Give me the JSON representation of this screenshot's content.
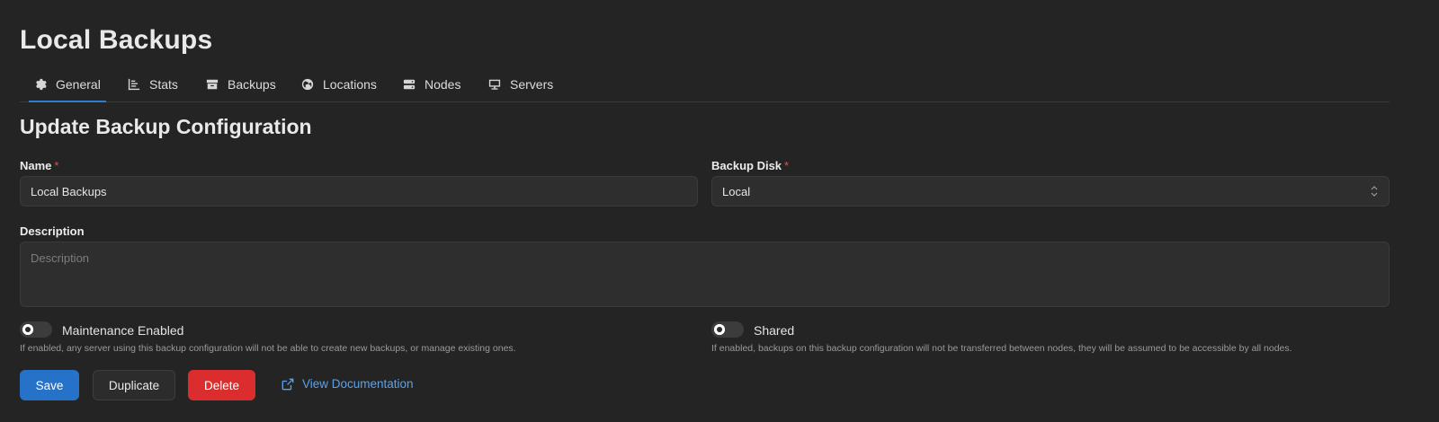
{
  "page": {
    "title": "Local Backups"
  },
  "tabs": [
    {
      "label": "General",
      "icon": "gear-icon",
      "active": true
    },
    {
      "label": "Stats",
      "icon": "bar-chart-icon"
    },
    {
      "label": "Backups",
      "icon": "archive-icon"
    },
    {
      "label": "Locations",
      "icon": "globe-icon"
    },
    {
      "label": "Nodes",
      "icon": "server-icon"
    },
    {
      "label": "Servers",
      "icon": "monitor-icon"
    }
  ],
  "form": {
    "title": "Update Backup Configuration",
    "name": {
      "label": "Name",
      "required_mark": "*",
      "value": "Local Backups"
    },
    "backup_disk": {
      "label": "Backup Disk",
      "required_mark": "*",
      "value": "Local"
    },
    "description": {
      "label": "Description",
      "placeholder": "Description",
      "value": ""
    },
    "maintenance": {
      "label": "Maintenance Enabled",
      "enabled": false,
      "help": "If enabled, any server using this backup configuration will not be able to create new backups, or manage existing ones."
    },
    "shared": {
      "label": "Shared",
      "enabled": false,
      "help": "If enabled, backups on this backup configuration will not be transferred between nodes, they will be assumed to be accessible by all nodes."
    }
  },
  "actions": {
    "save": "Save",
    "duplicate": "Duplicate",
    "delete": "Delete",
    "docs": "View Documentation"
  },
  "colors": {
    "background": "#242424",
    "accent": "#2f7cd1",
    "save": "#2672c8",
    "delete": "#db2d2d",
    "link": "#5aa3ea",
    "required": "#e05252"
  }
}
